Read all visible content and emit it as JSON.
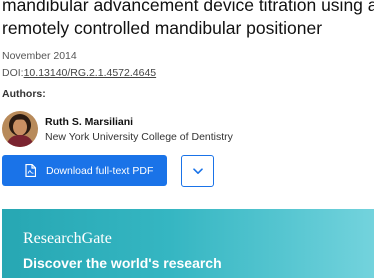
{
  "publication": {
    "title_line1": "mandibular advancement device titration using a",
    "title_line2": "remotely controlled mandibular positioner",
    "date": "November 2014",
    "doi_prefix": "DOI:",
    "doi": "10.13140/RG.2.1.4572.4645"
  },
  "authors": {
    "label": "Authors:",
    "items": [
      {
        "name": "Ruth S. Marsiliani",
        "institution": "New York University College of Dentistry",
        "avatar_icon": "author-photo"
      }
    ]
  },
  "actions": {
    "download_label": "Download full-text PDF",
    "download_icon": "pdf-file-icon",
    "more_icon": "chevron-down-icon"
  },
  "banner": {
    "logo": "ResearchGate",
    "tagline": "Discover the world's research"
  },
  "colors": {
    "primary": "#1a73e8",
    "banner_start": "#27a7b3",
    "banner_end": "#73d3dd",
    "text": "#111111"
  }
}
